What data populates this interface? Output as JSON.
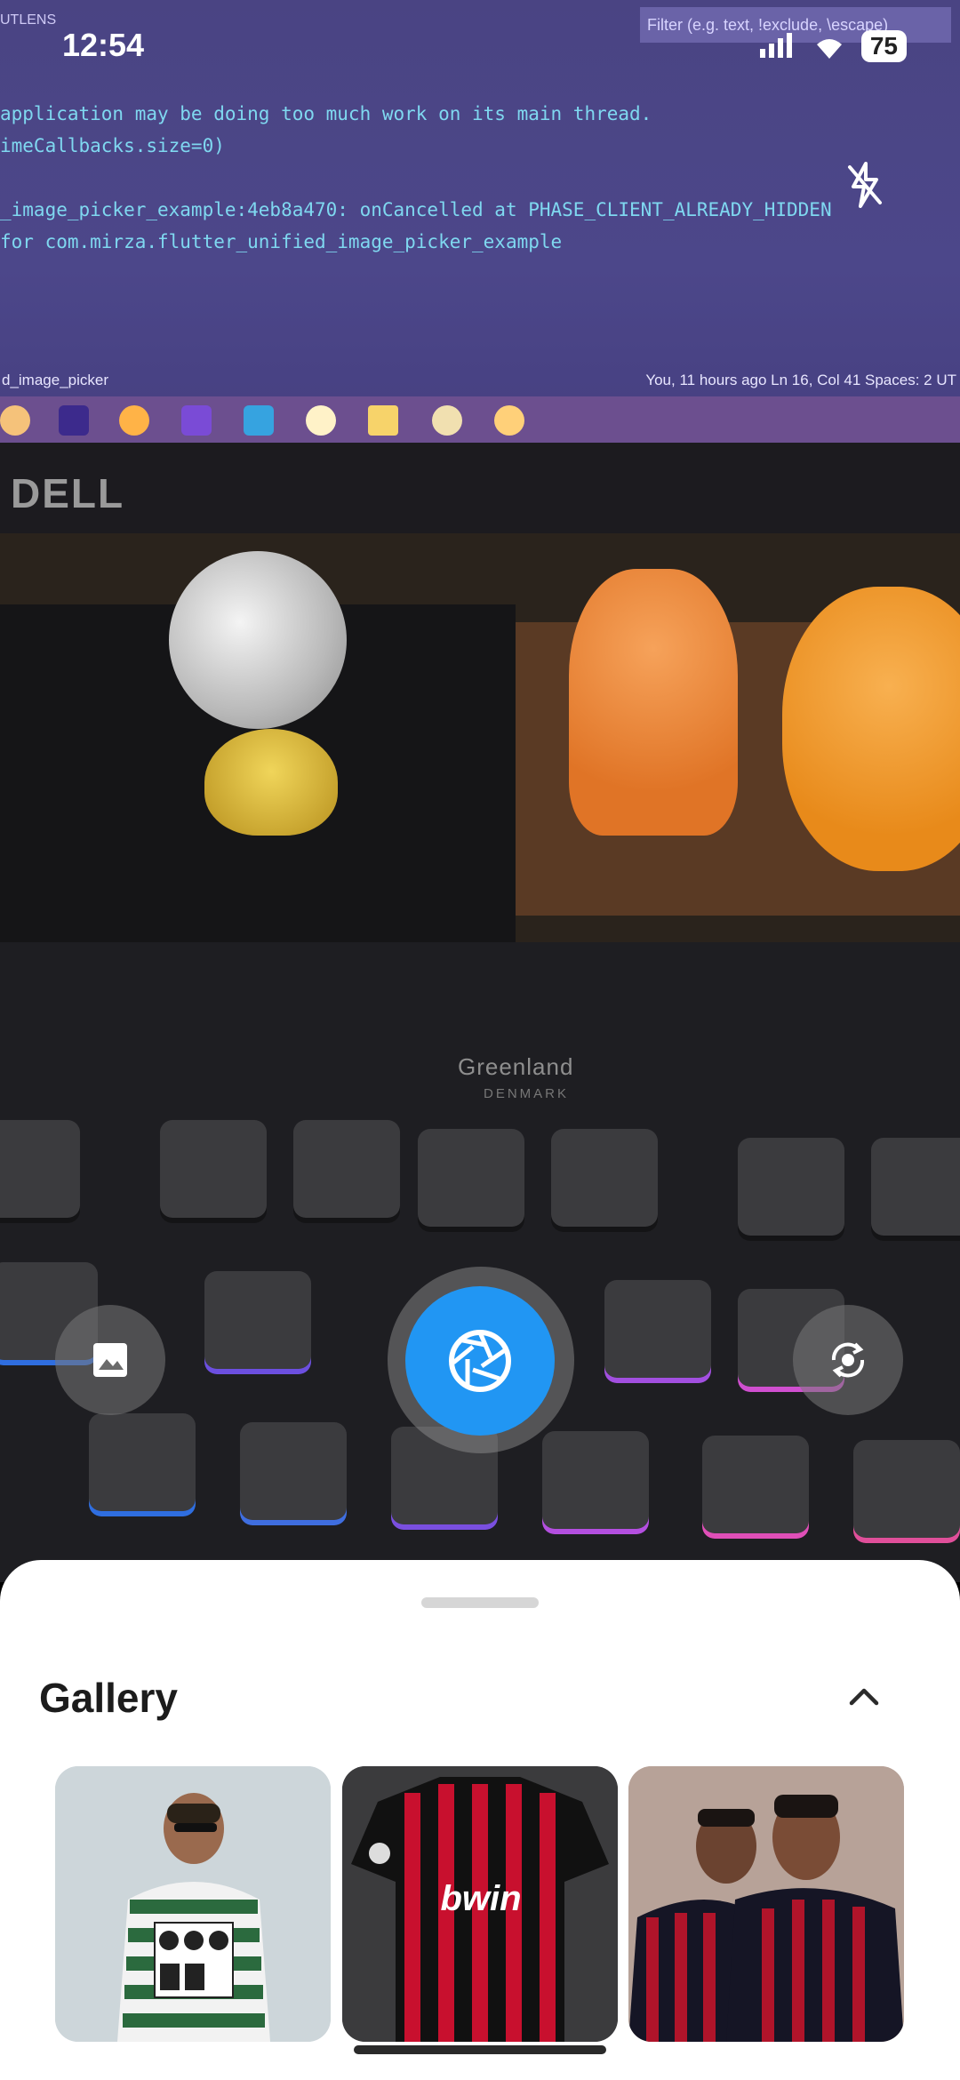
{
  "status_bar": {
    "time": "12:54",
    "battery_level": "75",
    "icons": [
      "signal-icon",
      "wifi-icon",
      "battery-icon"
    ]
  },
  "camera": {
    "flash_icon": "flash-off-icon",
    "gallery_button_icon": "image-icon",
    "shutter_icon": "aperture-icon",
    "switch_camera_icon": "camera-switch-icon",
    "shutter_color": "#2196f3"
  },
  "scene_text": {
    "code_lines": [
      "application may be doing too much work on its main thread.",
      "imeCallbacks.size=0)",
      "",
      "_image_picker_example:4eb8a470: onCancelled at PHASE_CLIENT_ALREADY_HIDDEN",
      "for com.mirza.flutter_unified_image_picker_example"
    ],
    "filter_hint": "Filter (e.g. text, !exclude, \\escape)",
    "tab_label": "UTLENS",
    "status_left": "d_image_picker",
    "status_right": "You, 11 hours ago   Ln 16, Col 41   Spaces: 2   UT",
    "monitor_brand": "DELL",
    "keyboard_brand": "Greenland",
    "keyboard_sub": "DENMARK"
  },
  "sheet": {
    "title": "Gallery",
    "collapse_icon": "chevron-up-icon",
    "thumbnails": [
      {
        "name": "photo-man-sporting-jersey"
      },
      {
        "name": "photo-ac-milan-jersey",
        "text": "bwin"
      },
      {
        "name": "photo-two-friends-selfie"
      }
    ]
  }
}
